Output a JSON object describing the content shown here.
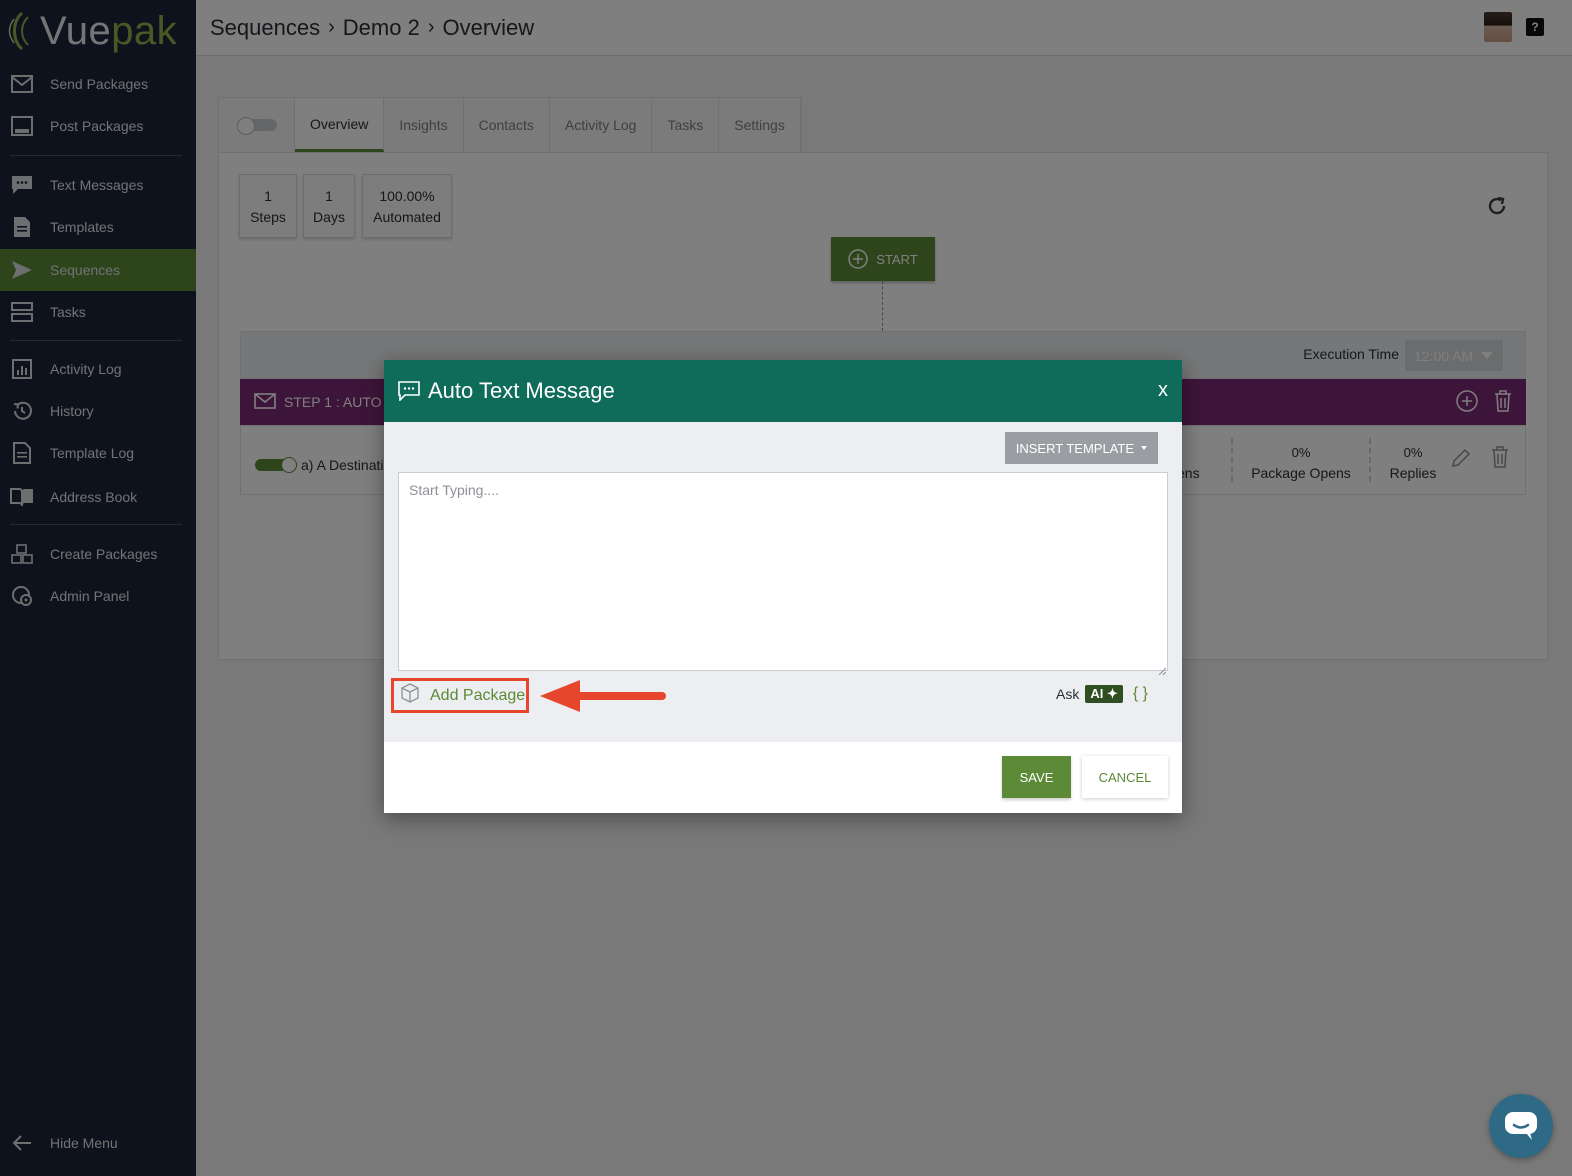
{
  "brand": {
    "logo_text_main": "Vue",
    "logo_text_accent": "pak",
    "accent_color": "#5d8a36"
  },
  "sidebar": {
    "items": [
      {
        "label": "Send Packages",
        "icon": "envelope-icon"
      },
      {
        "label": "Post Packages",
        "icon": "inbox-icon"
      },
      {
        "label": "Text Messages",
        "icon": "chat-icon"
      },
      {
        "label": "Templates",
        "icon": "document-icon"
      },
      {
        "label": "Sequences",
        "icon": "send-icon",
        "active": true
      },
      {
        "label": "Tasks",
        "icon": "tasks-icon"
      },
      {
        "label": "Activity Log",
        "icon": "bar-chart-icon"
      },
      {
        "label": "History",
        "icon": "history-icon"
      },
      {
        "label": "Template Log",
        "icon": "document-icon"
      },
      {
        "label": "Address Book",
        "icon": "book-icon"
      },
      {
        "label": "Create Packages",
        "icon": "boxes-icon"
      },
      {
        "label": "Admin Panel",
        "icon": "admin-icon"
      }
    ],
    "hide_menu": "Hide Menu"
  },
  "header": {
    "breadcrumb": [
      "Sequences",
      "Demo 2",
      "Overview"
    ],
    "help": "?"
  },
  "tabs": [
    "Overview",
    "Insights",
    "Contacts",
    "Activity Log",
    "Tasks",
    "Settings"
  ],
  "stats": [
    {
      "value": "1",
      "label": "Steps"
    },
    {
      "value": "1",
      "label": "Days"
    },
    {
      "value": "100.00%",
      "label": "Automated"
    }
  ],
  "flow": {
    "start_label": "START",
    "execution_time_label": "Execution Time",
    "execution_time_value": "12:00 AM",
    "step_title": "STEP 1 : AUTO E",
    "row_title": "a) A Destinati",
    "metric_partial": "ens",
    "metrics": [
      {
        "pct": "0%",
        "label": "Package Opens"
      },
      {
        "pct": "0%",
        "label": "Replies"
      }
    ]
  },
  "modal": {
    "title": "Auto Text Message",
    "close": "x",
    "insert_template": "INSERT TEMPLATE",
    "message_placeholder": "Start Typing....",
    "message_value": "",
    "add_package": "Add Package",
    "ask_label": "Ask",
    "ai_badge": "AI",
    "braces": "{ }",
    "save": "SAVE",
    "cancel": "CANCEL"
  }
}
